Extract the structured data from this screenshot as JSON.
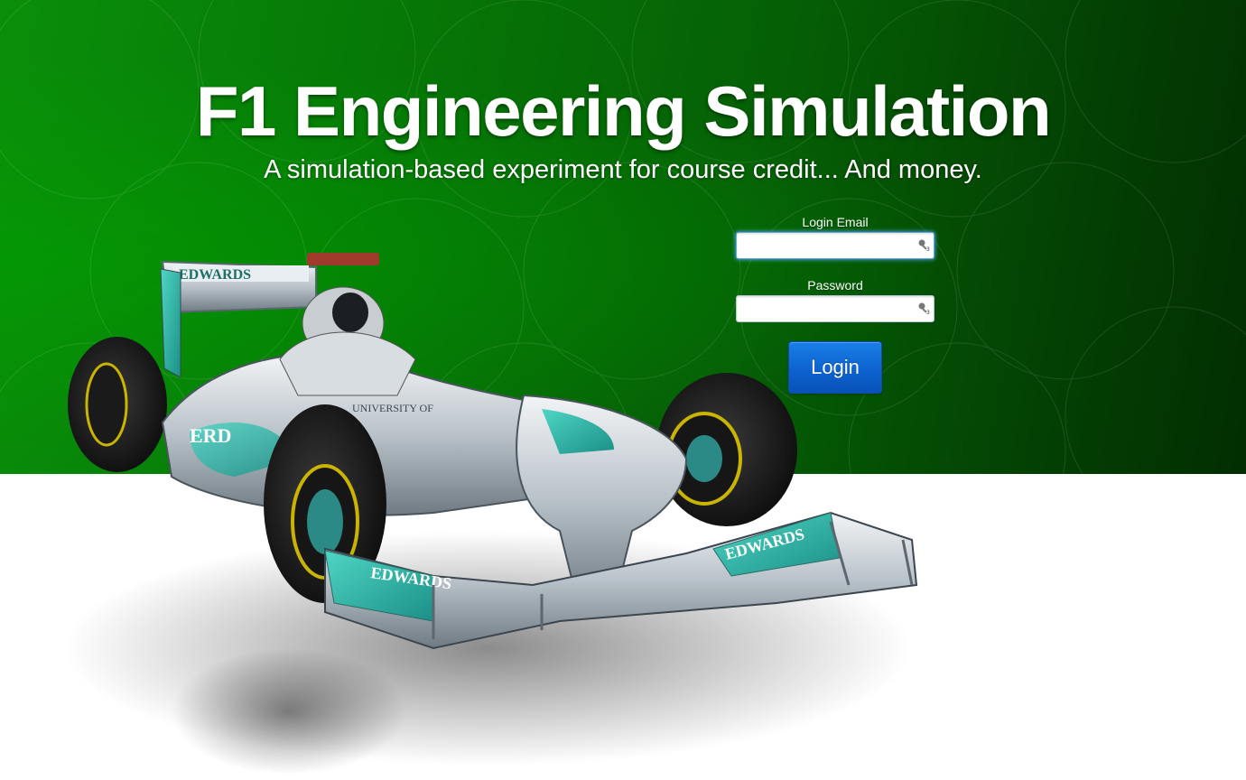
{
  "header": {
    "title": "F1 Engineering Simulation",
    "subtitle": "A simulation-based experiment for course credit... And money."
  },
  "login": {
    "email_label": "Login Email",
    "email_value": "",
    "password_label": "Password",
    "password_value": "",
    "submit_label": "Login",
    "field_icon": "password-manager-key-icon"
  },
  "hero_image": {
    "description_icon": "f1-car-image",
    "car_livery_text": "EDWARDS"
  },
  "colors": {
    "hero_green": "#067806",
    "hero_dark_green": "#022e02",
    "button_blue": "#0d62cf",
    "text_white": "#ffffff"
  }
}
